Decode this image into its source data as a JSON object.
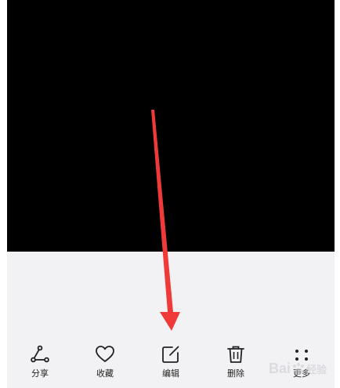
{
  "toolbar": {
    "items": [
      {
        "label": "分享",
        "icon": "share-icon"
      },
      {
        "label": "收藏",
        "icon": "heart-icon"
      },
      {
        "label": "编辑",
        "icon": "edit-icon"
      },
      {
        "label": "删除",
        "icon": "trash-icon"
      },
      {
        "label": "更多",
        "icon": "more-icon"
      }
    ]
  },
  "watermark": {
    "text": "Bai",
    "text2": "经验"
  },
  "colors": {
    "arrow": "#f03a3a",
    "toolbar_bg": "#f2f2f4",
    "photo_bg": "#000000"
  }
}
